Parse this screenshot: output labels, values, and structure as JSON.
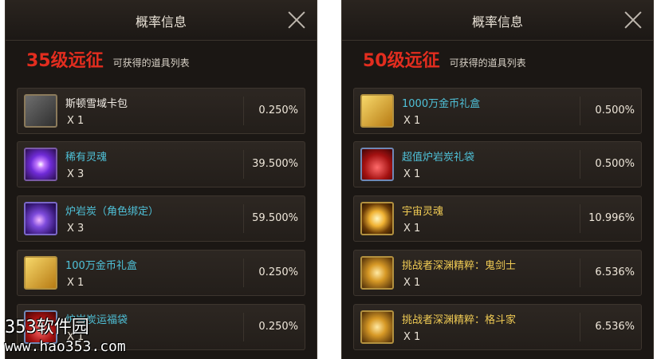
{
  "panels": [
    {
      "title": "概率信息",
      "level": "35级远征",
      "subtitle": "可获得的道具列表",
      "items": [
        {
          "name": "斯顿雪域卡包",
          "qty": "X 1",
          "prob": "0.250%",
          "name_color": "white",
          "icon": "card-pack-icon",
          "icon_style": "grey"
        },
        {
          "name": "稀有灵魂",
          "qty": "X 3",
          "prob": "39.500%",
          "name_color": "blue",
          "icon": "rare-soul-icon",
          "icon_style": "purple"
        },
        {
          "name": "炉岩炭（角色绑定）",
          "qty": "X 3",
          "prob": "59.500%",
          "name_color": "blue",
          "icon": "lava-charcoal-icon",
          "icon_style": "lava"
        },
        {
          "name": "100万金币礼盒",
          "qty": "X 1",
          "prob": "0.250%",
          "name_color": "blue",
          "icon": "gold-coin-box-icon",
          "icon_style": "gold"
        },
        {
          "name": "炉岩炭运福袋",
          "qty": "X 1",
          "prob": "0.250%",
          "name_color": "blue",
          "icon": "lucky-bag-icon",
          "icon_style": "red"
        }
      ]
    },
    {
      "title": "概率信息",
      "level": "50级远征",
      "subtitle": "可获得的道具列表",
      "items": [
        {
          "name": "1000万金币礼盒",
          "qty": "X 1",
          "prob": "0.500%",
          "name_color": "blue",
          "icon": "gold-coin-box-icon",
          "icon_style": "gold"
        },
        {
          "name": "超值炉岩炭礼袋",
          "qty": "X 1",
          "prob": "0.500%",
          "name_color": "blue",
          "icon": "gift-bag-icon",
          "icon_style": "red"
        },
        {
          "name": "宇宙灵魂",
          "qty": "X 1",
          "prob": "10.996%",
          "name_color": "gold",
          "icon": "cosmic-soul-icon",
          "icon_style": "orb"
        },
        {
          "name": "挑战者深渊精粹：鬼剑士",
          "qty": "X 1",
          "prob": "6.536%",
          "name_color": "gold",
          "icon": "abyss-essence-icon",
          "icon_style": "flower"
        },
        {
          "name": "挑战者深渊精粹：格斗家",
          "qty": "X 1",
          "prob": "6.536%",
          "name_color": "gold",
          "icon": "abyss-essence-icon",
          "icon_style": "flower"
        }
      ]
    }
  ],
  "watermark": {
    "line1": "353软件园",
    "line2": "www.hao353.com"
  }
}
